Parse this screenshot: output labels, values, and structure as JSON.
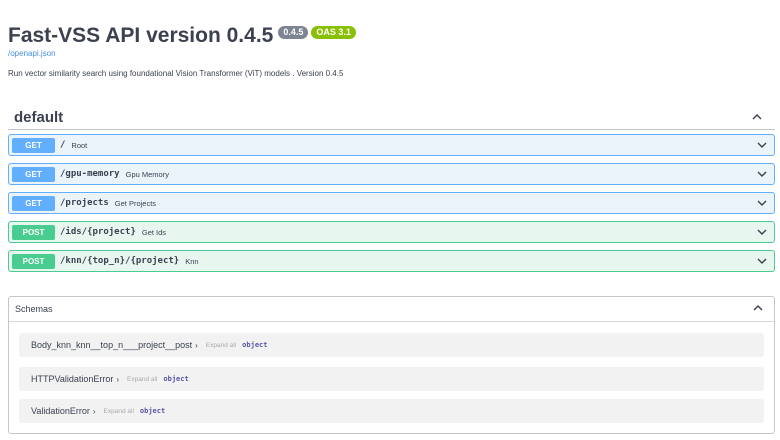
{
  "info": {
    "title": "Fast-VSS API version 0.4.5",
    "version_badge": "0.4.5",
    "oas_badge": "OAS 3.1",
    "spec_link": "/openapi.json",
    "description": "Run vector similarity search using foundational Vision Transformer (ViT) models . Version 0.4.5"
  },
  "tag": {
    "name": "default"
  },
  "operations": [
    {
      "method": "GET",
      "path": "/",
      "summary": "Root"
    },
    {
      "method": "GET",
      "path": "/gpu-memory",
      "summary": "Gpu Memory"
    },
    {
      "method": "GET",
      "path": "/projects",
      "summary": "Get Projects"
    },
    {
      "method": "POST",
      "path": "/ids/{project}",
      "summary": "Get Ids"
    },
    {
      "method": "POST",
      "path": "/knn/{top_n}/{project}",
      "summary": "Knn"
    }
  ],
  "schemas": {
    "title": "Schemas",
    "models": [
      {
        "name": "Body_knn_knn__top_n___project__post",
        "expand": "Expand all",
        "type": "object"
      },
      {
        "name": "HTTPValidationError",
        "expand": "Expand all",
        "type": "object"
      },
      {
        "name": "ValidationError",
        "expand": "Expand all",
        "type": "object"
      }
    ]
  },
  "colors": {
    "get": "#61affe",
    "post": "#49cc90",
    "oas": "#89bf04",
    "version": "#7d8492"
  }
}
